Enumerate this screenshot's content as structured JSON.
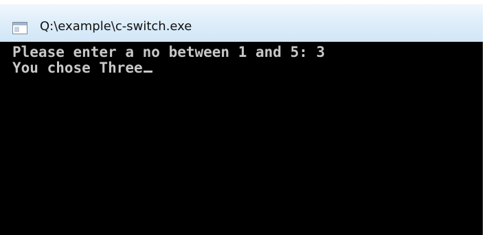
{
  "window": {
    "title": "Q:\\example\\c-switch.exe",
    "icon": "console-app-icon"
  },
  "console": {
    "lines": [
      "Please enter a no between 1 and 5: 3",
      "You chose Three"
    ]
  }
}
